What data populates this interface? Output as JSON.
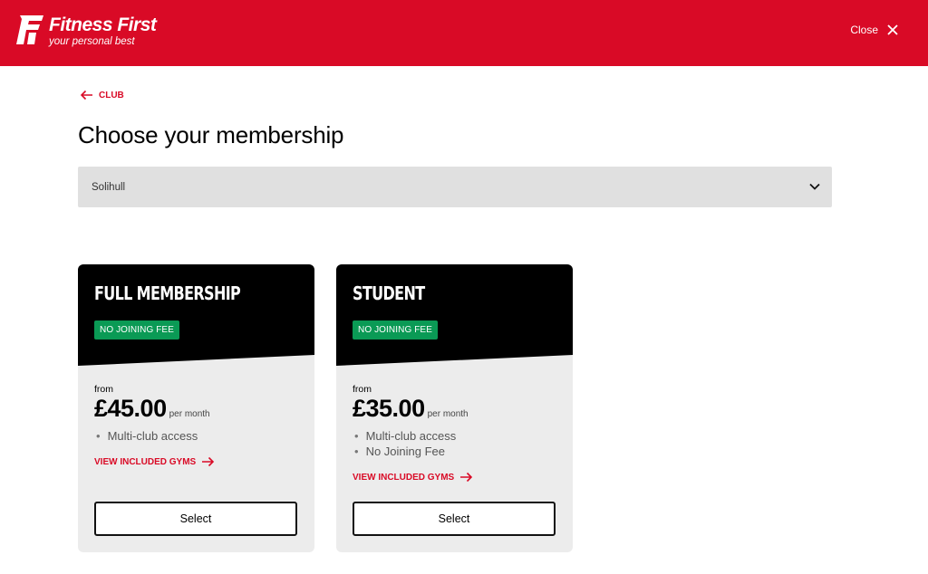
{
  "header": {
    "brand_name": "Fitness First",
    "brand_tagline": "your personal best",
    "close_label": "Close",
    "background": "#d90a26"
  },
  "nav": {
    "back_label": "CLUB"
  },
  "page": {
    "title": "Choose your membership"
  },
  "club_select": {
    "value": "Solihull"
  },
  "memberships": [
    {
      "name": "FULL MEMBERSHIP",
      "badge": "NO JOINING FEE",
      "from_label": "from",
      "price": "£45.00",
      "price_unit": "per month",
      "features": [
        "Multi-club access"
      ],
      "gyms_link": "VIEW INCLUDED GYMS",
      "select_label": "Select"
    },
    {
      "name": "STUDENT",
      "badge": "NO JOINING FEE",
      "from_label": "from",
      "price": "£35.00",
      "price_unit": "per month",
      "features": [
        "Multi-club access",
        "No Joining Fee"
      ],
      "gyms_link": "VIEW INCLUDED GYMS",
      "select_label": "Select"
    }
  ],
  "colors": {
    "accent": "#d90a26",
    "badge": "#0a9a55",
    "card_bg": "#ececec"
  }
}
